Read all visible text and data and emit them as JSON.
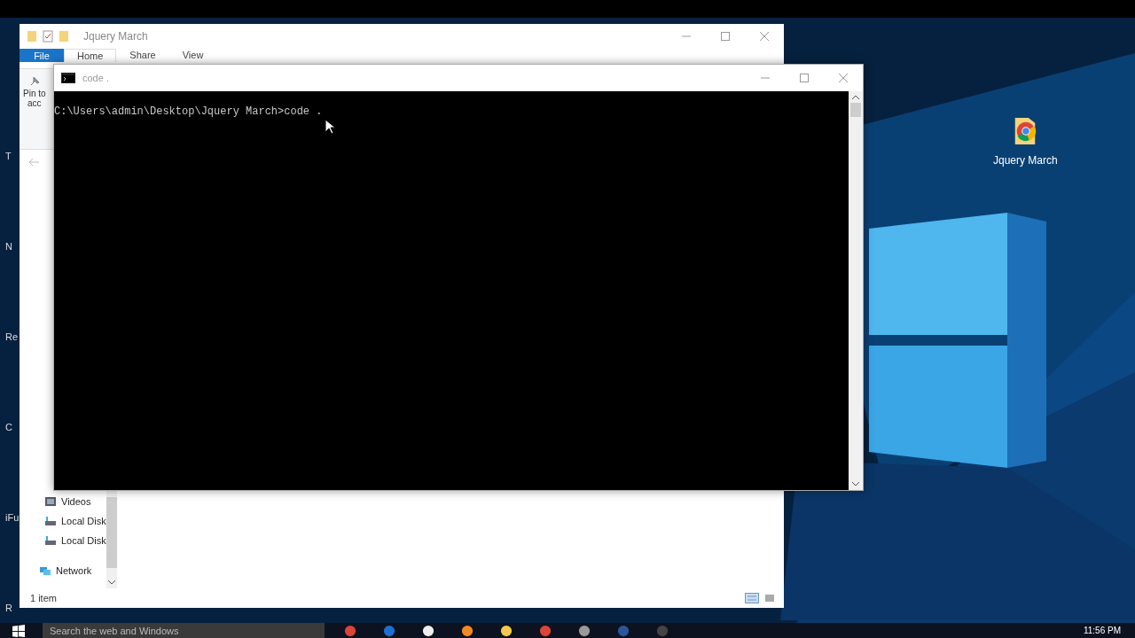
{
  "desktop": {
    "icons": [
      {
        "label": "Jquery March"
      }
    ],
    "edge_labels": [
      "T",
      "N",
      "Re",
      "C",
      "iFu",
      "R"
    ]
  },
  "explorer": {
    "title": "Jquery March",
    "file_menu": "File",
    "ribbon_tabs": [
      {
        "label": "Home",
        "selected": true
      },
      {
        "label": "Share",
        "selected": false
      },
      {
        "label": "View",
        "selected": false
      }
    ],
    "pin_label": [
      "Pin to",
      "acc"
    ],
    "nav_items": [
      {
        "label": "Videos",
        "kind": "videos"
      },
      {
        "label": "Local Disk",
        "kind": "disk"
      },
      {
        "label": "Local Disk",
        "kind": "disk"
      },
      {
        "label": "Network",
        "kind": "network"
      }
    ],
    "status_bar": "1 item"
  },
  "console": {
    "title": "code .",
    "lines": [
      "C:\\Users\\admin\\Desktop\\Jquery March>code ."
    ]
  },
  "taskbar": {
    "search_placeholder": "Search the web and Windows",
    "clock": "11:56 PM"
  }
}
